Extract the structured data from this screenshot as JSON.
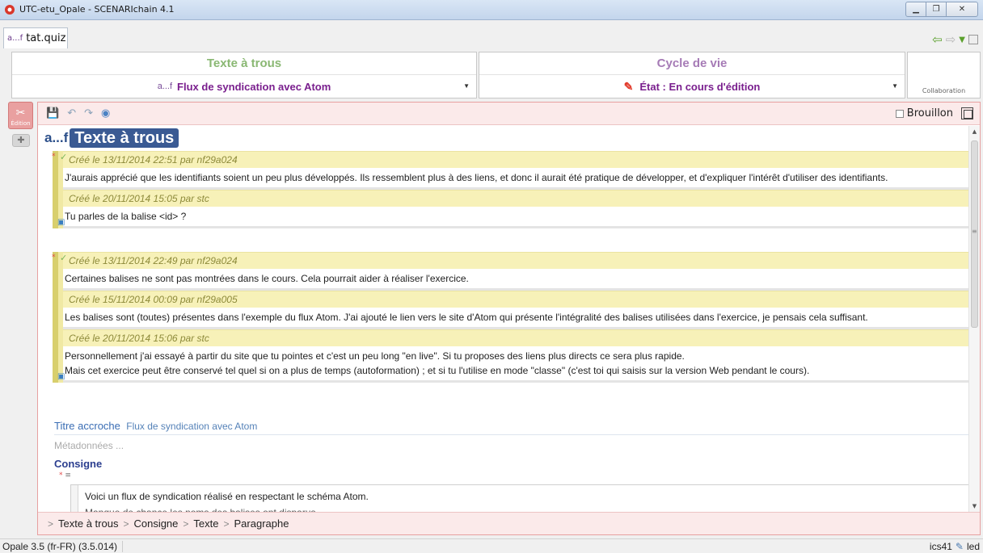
{
  "window": {
    "title": "UTC-etu_Opale - SCENARIchain 4.1"
  },
  "tab": {
    "kind": "a...f",
    "name": "tat.quiz"
  },
  "header": {
    "panel1": {
      "title": "Texte à trous",
      "kind": "a...f",
      "value": "Flux de syndication avec Atom"
    },
    "panel2": {
      "title": "Cycle de vie",
      "value": "État : En cours d'édition"
    },
    "panel3": {
      "label": "Collaboration"
    }
  },
  "sidebar": {
    "edit_label": "Édition"
  },
  "toolbar": {
    "brouillon_label": "Brouillon"
  },
  "document": {
    "kind": "a...f",
    "title": "Texte à trous"
  },
  "comment_threads": [
    {
      "comments": [
        {
          "header": "Créé le 13/11/2014 22:51 par nf29a024",
          "body": "J'aurais apprécié que les identifiants soient un peu plus développés. Ils ressemblent plus à des liens, et donc il aurait été pratique de développer, et d'expliquer l'intérêt d'utiliser des identifiants."
        },
        {
          "header": "Créé le 20/11/2014 15:05 par stc",
          "body": "Tu parles de la balise <id> ?"
        }
      ]
    },
    {
      "comments": [
        {
          "header": "Créé le 13/11/2014 22:49 par nf29a024",
          "body": "Certaines balises ne sont pas montrées dans le cours. Cela pourrait aider à réaliser l'exercice."
        },
        {
          "header": "Créé le 15/11/2014 00:09 par nf29a005",
          "body": "Les balises sont (toutes) présentes dans l'exemple du flux Atom. J'ai ajouté le lien vers le site d'Atom qui présente l'intégralité des balises utilisées dans l'exercice, je pensais cela suffisant."
        },
        {
          "header": "Créé le 20/11/2014 15:06 par stc",
          "body_line1": "Personnellement j'ai essayé à partir du site que tu pointes et c'est un peu long \"en live\". Si tu proposes des liens plus directs ce sera plus rapide.",
          "body_line2": "Mais cet exercice peut être conservé tel quel si on a plus de temps (autoformation) ; et si tu l'utilise en mode  \"classe\" (c'est toi qui saisis sur la version Web pendant le cours)."
        }
      ]
    }
  ],
  "fields": {
    "titre_accroche_label": "Titre accroche",
    "titre_accroche_value": "Flux de syndication avec Atom",
    "metadonnees_label": "Métadonnées ...",
    "consigne_label": "Consigne",
    "consigne_line1": "Voici un flux de syndication réalisé en respectant le schéma Atom.",
    "consigne_line2": "Manque de chance les noms des balises ont disparus."
  },
  "breadcrumb": [
    "Texte à trous",
    "Consigne",
    "Texte",
    "Paragraphe"
  ],
  "status": {
    "left": "Opale 3.5 (fr-FR) (3.5.014)",
    "right": "ics41",
    "right2": "led"
  }
}
